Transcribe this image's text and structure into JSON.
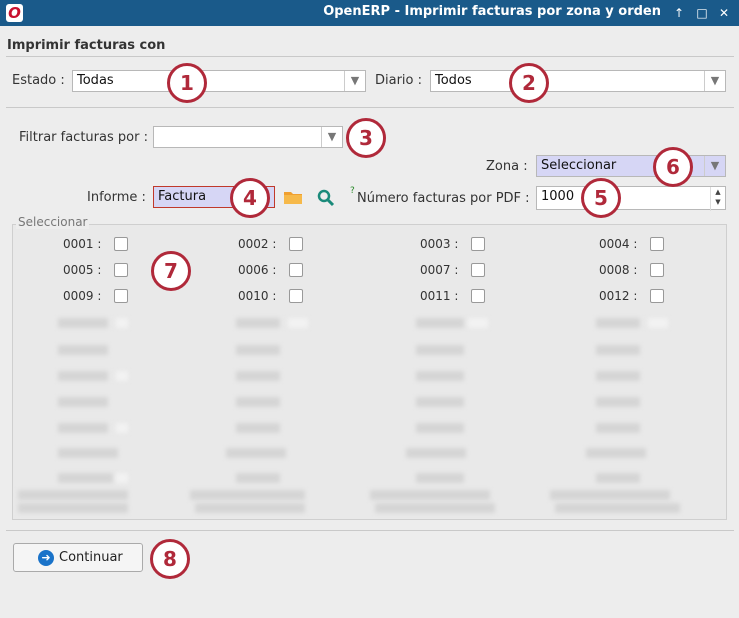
{
  "window": {
    "title": "OpenERP - Imprimir facturas por zona y orden",
    "app_icon": "O",
    "buttons": [
      "↑",
      "□",
      "✕"
    ]
  },
  "section_title": "Imprimir facturas con",
  "estado": {
    "label": "Estado :",
    "value": "Todas"
  },
  "diario": {
    "label": "Diario :",
    "value": "Todos"
  },
  "filtrar": {
    "label": "Filtrar facturas por :",
    "value": ""
  },
  "zona": {
    "label": "Zona :",
    "value": "Seleccionar"
  },
  "informe": {
    "label": "Informe :",
    "value": "Factura"
  },
  "numero": {
    "help": "?",
    "label": "Número facturas por PDF :",
    "value": "1000"
  },
  "seleccionar_group": {
    "title": "Seleccionar",
    "items": [
      "0001 :",
      "0002 :",
      "0003 :",
      "0004 :",
      "0005 :",
      "0006 :",
      "0007 :",
      "0008 :",
      "0009 :",
      "0010 :",
      "0011 :",
      "0012 :"
    ]
  },
  "continuar": {
    "label": "Continuar",
    "icon": "arrow-right-icon"
  },
  "annotations": [
    "1",
    "2",
    "3",
    "4",
    "5",
    "6",
    "7",
    "8"
  ],
  "colors": {
    "annotation": "#b0293a",
    "titlebar": "#1a5a8a",
    "highlight": "#d6d6f5"
  }
}
